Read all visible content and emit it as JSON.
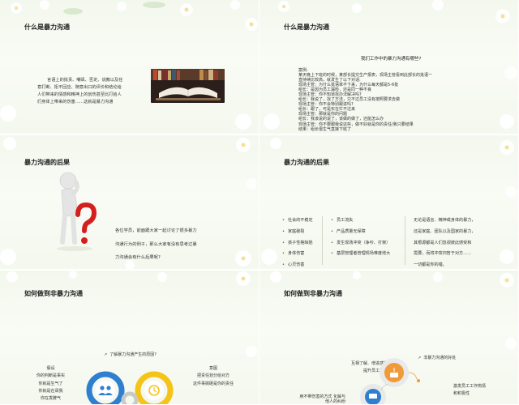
{
  "slide1": {
    "title": "什么是暴力沟通",
    "body": "言语上的批责、嘲讽、否定、说教以及任意打断、拒不回应，随意出口的评价和结论给人们带来的情感和精神上的创伤甚至比肉体的伤害还要令人痛苦。这就是暴力沟通",
    "body_lines": [
      "言语上的批责、嘲讽、否定、说教以及任",
      "意打断、拒不回应、随意出口的评价和结论给",
      "人们带来的情感和精神上的创伤甚至比打给人",
      "们身体上带来的伤害……这就是暴力沟通"
    ],
    "image": "open-book-photo"
  },
  "slide2": {
    "title": "什么是暴力沟通",
    "question": "我们工作中的暴力沟通有哪些?",
    "dialog_lines": [
      "案例:",
      "    某天晚上下班的时候，某部长提交生产报表，现场主管看到此部长的批语一",
      "直持续比较高，就发生了以下对话:",
      "现场主管：为什么批语率不下来，为什么每天都是5-6批",
      "组长：是因为员工漏检，还是同一种不良",
      "现场主管：你不知道找办法解决吗?",
      "组长：我说了，找了方法，只不过员工没有按照要求去做",
      "现场主管：你不会特别跟进吗?",
      "组长：跟了，可是实在忙不过来",
      "现场主管：那就是你的问题",
      "组长：我该说的说了，该做的做了，还能怎么办",
      "现场主管：你不要跟我说这些，做不好就是你的责任/我只要结果",
      "结果：组长很生气直接下班了"
    ]
  },
  "slide3": {
    "title": "暴力沟通的后果",
    "body_lines": [
      "各位学员，前面跟大家一起讨论了很多暴力",
      "沟通行为的例子，那么大家有没有思考过暴",
      "力沟通会有什么后果呢?"
    ],
    "figure": "question-mark-figure"
  },
  "slide4": {
    "title": "暴力沟通的后果",
    "col1": [
      "社会的不稳定",
      "家庭破裂",
      "孩子性格缺陷",
      "身体伤害",
      "心灵伤害"
    ],
    "col2": [
      "员工流失",
      "产品质量无保障",
      "发生现场冲突（争吵、打架）",
      "基层管理者管理现场难度增大"
    ],
    "col3": [
      "无论是语言、精神或身体的暴力，",
      "还是家庭、团队以及国家的暴力，",
      "其根源都是人们忽视彼此感受和",
      "需要，而将冲突归咎于对方……",
      "一切都是你的错。"
    ]
  },
  "slide5": {
    "title": "如何做到非暴力沟通",
    "arrow_text": "了解暴力沟通产生的原因?",
    "left_label_title": "假设",
    "left_lines": [
      "假设",
      "你的判断是事实",
      "你就是生气了",
      "你就是在讽我",
      "你在发脾气"
    ],
    "right_lines": [
      "意图",
      "把责任划分给对方",
      "这件事搞砸是你的责任"
    ],
    "colors": {
      "blue": "#2f7fd0",
      "yellow": "#f5c418",
      "gray": "#c9c9c9"
    }
  },
  "slide6": {
    "title": "如何做到非暴力沟通",
    "subtitle": "非暴力沟通的好处",
    "lbl1_lines": [
      "互相了解、增进感情，",
      "提升员工归属感"
    ],
    "lbl2_lines": [
      "激发员工工作热情",
      "和积极性"
    ],
    "lbl3_lines": [
      "用不带伤害的方式 化解与",
      "他人的纠纷"
    ],
    "colors": {
      "orange": "#f09a3a",
      "blue": "#2f7fd0",
      "gray": "#e0e0e0"
    }
  }
}
